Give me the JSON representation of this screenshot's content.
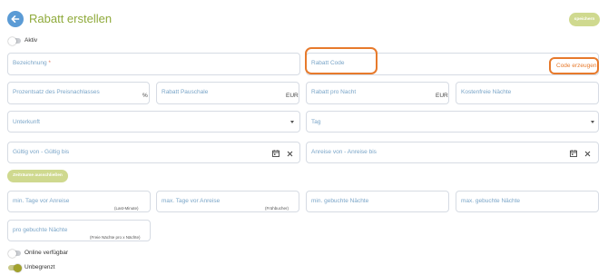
{
  "header": {
    "title": "Rabatt erstellen",
    "save_label": "speichern"
  },
  "toggles": {
    "active_label": "Aktiv",
    "online_label": "Online verfügbar",
    "unlimited_label": "Unbegrenzt"
  },
  "fields": {
    "bezeichnung": "Bezeichnung",
    "required_mark": "*",
    "rabatt_code": "Rabatt Code",
    "code_erzeugen": "Code erzeugen",
    "prozentsatz": "Prozentsatz des Preisnachlasses",
    "prozent_suffix": "%",
    "pauschale": "Rabatt Pauschale",
    "eur1": "EUR",
    "pro_nacht": "Rabatt pro Nacht",
    "eur2": "EUR",
    "kostenfreie": "Kostenfreie Nächte",
    "unterkunft": "Unterkunft",
    "tag": "Tag",
    "gueltig": "Gültig von - Gültig bis",
    "anreise": "Anreise von - Anreise bis",
    "min_tage": "min. Tage vor Anreise",
    "min_tage_hint": "(Last-Minute)",
    "max_tage": "max. Tage vor Anreise",
    "max_tage_hint": "(Frühbucher)",
    "min_naechte": "min. gebuchte Nächte",
    "max_naechte": "max. gebuchte Nächte",
    "pro_gebuchte": "pro gebuchte Nächte",
    "pro_gebuchte_hint": "(Freie Nächte pro x Nächte)"
  },
  "buttons": {
    "zeitraeume": "Zeiträume ausschließen"
  },
  "icons": {
    "back": "back-arrow-icon",
    "calendar": "calendar-icon",
    "clear": "close-icon",
    "dropdown": "chevron-down-icon"
  },
  "colors": {
    "title_green": "#8faa3b",
    "label_blue": "#7aa5c8",
    "highlight_orange": "#e77a2c",
    "button_green": "#cfd98f",
    "toggle_on": "#a2a22b"
  }
}
